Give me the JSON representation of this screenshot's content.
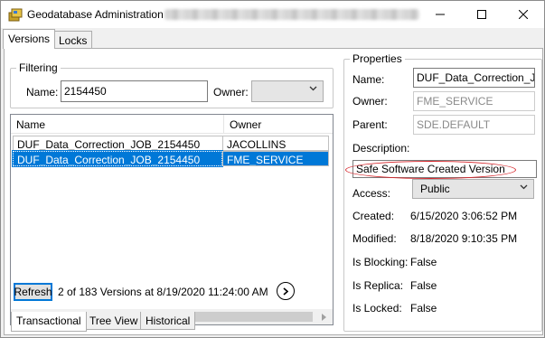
{
  "window": {
    "title": "Geodatabase Administration"
  },
  "tabs": {
    "versions": "Versions",
    "locks": "Locks"
  },
  "filtering": {
    "caption": "Filtering",
    "name_label": "Name:",
    "name_value": "2154450",
    "owner_label": "Owner:",
    "owner_value": ""
  },
  "versions_list": {
    "columns": [
      "Name",
      "Owner"
    ],
    "rows": [
      {
        "name": "DUF_Data_Correction_JOB_2154450",
        "owner": "JACOLLINS",
        "selected": false
      },
      {
        "name": "DUF_Data_Correction_JOB_2154450",
        "owner": "FME_SERVICE",
        "selected": true
      }
    ]
  },
  "footer": {
    "refresh_label": "Refresh",
    "status": "2 of 183 Versions at 8/19/2020 11:24:00 AM"
  },
  "bottom_tabs": {
    "transactional": "Transactional",
    "tree_view": "Tree View",
    "historical": "Historical"
  },
  "properties": {
    "caption": "Properties",
    "name_label": "Name:",
    "name_value": "DUF_Data_Correction_JO",
    "owner_label": "Owner:",
    "owner_value": "FME_SERVICE",
    "parent_label": "Parent:",
    "parent_value": "SDE.DEFAULT",
    "description_label": "Description:",
    "description_value": "Safe Software Created Version",
    "access_label": "Access:",
    "access_value": "Public",
    "created_label": "Created:",
    "created_value": "6/15/2020 3:06:52 PM",
    "modified_label": "Modified:",
    "modified_value": "8/18/2020 9:10:35 PM",
    "blocking_label": "Is Blocking:",
    "blocking_value": "False",
    "replica_label": "Is Replica:",
    "replica_value": "False",
    "locked_label": "Is Locked:",
    "locked_value": "False"
  },
  "colors": {
    "selection": "#0078d7",
    "annotation": "#d6252a"
  }
}
